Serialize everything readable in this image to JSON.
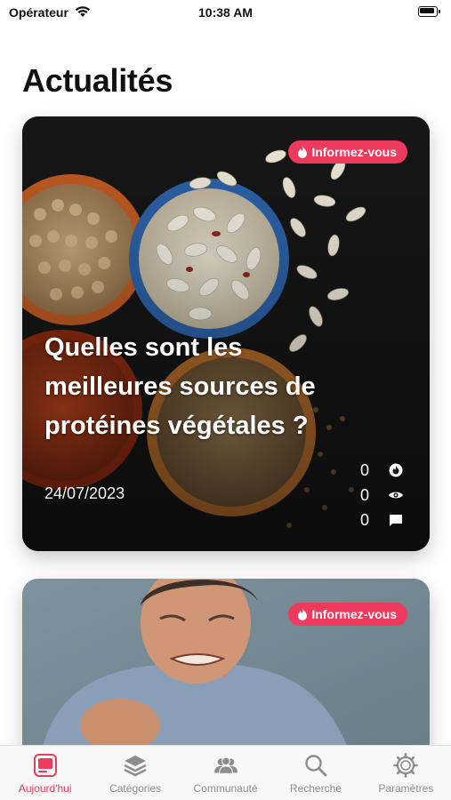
{
  "status_bar": {
    "carrier": "Opérateur",
    "time": "10:38 AM"
  },
  "page": {
    "title": "Actualités"
  },
  "colors": {
    "accent": "#ee3a5c",
    "tab_inactive": "#8c8c8c"
  },
  "articles": [
    {
      "badge": "Informez-vous",
      "title": "Quelles sont les meilleures sources de protéines végétales ?",
      "date": "24/07/2023",
      "stats": {
        "likes": "0",
        "views": "0",
        "comments": "0"
      },
      "image": "bowls-of-beans-lentils-chickpeas"
    },
    {
      "badge": "Informez-vous",
      "image": "man-grimacing-in-pain"
    }
  ],
  "tab_bar": {
    "items": [
      {
        "label": "Aujourd'hui",
        "icon": "today-icon",
        "active": true
      },
      {
        "label": "Catégories",
        "icon": "stack-icon",
        "active": false
      },
      {
        "label": "Communauté",
        "icon": "people-icon",
        "active": false
      },
      {
        "label": "Recherche",
        "icon": "search-icon",
        "active": false
      },
      {
        "label": "Paramètres",
        "icon": "gear-icon",
        "active": false
      }
    ]
  }
}
